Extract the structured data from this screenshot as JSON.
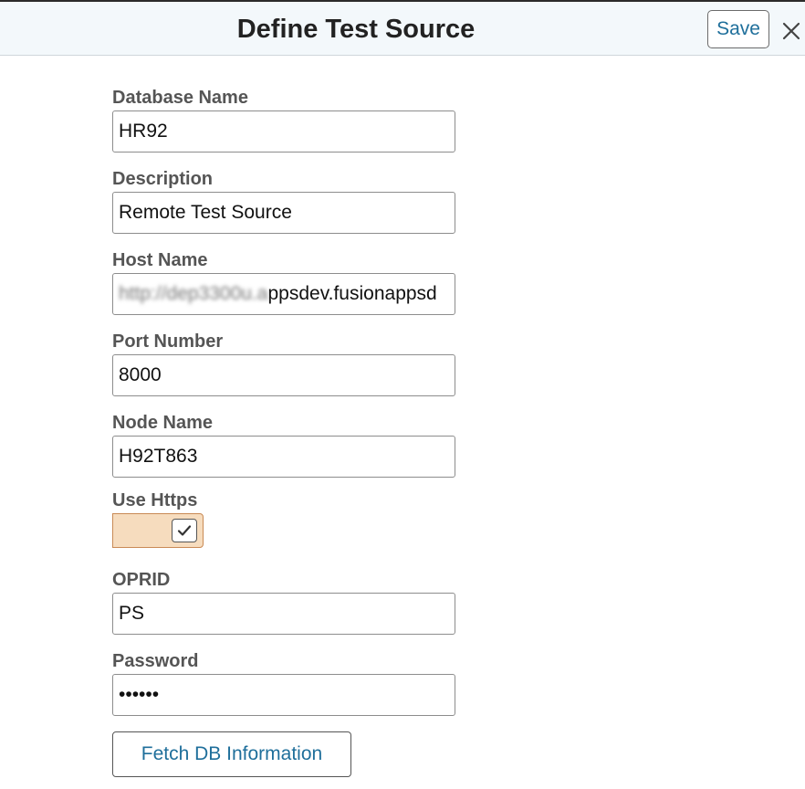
{
  "header": {
    "title": "Define Test Source",
    "save_label": "Save",
    "close_icon": "close-icon"
  },
  "form": {
    "database_name": {
      "label": "Database Name",
      "value": "HR92"
    },
    "description": {
      "label": "Description",
      "value": "Remote Test Source"
    },
    "host_name": {
      "label": "Host Name",
      "value_obscured": "http://dep3300u.a",
      "value_visible": "ppsdev.fusionappsd"
    },
    "port_number": {
      "label": "Port Number",
      "value": "8000"
    },
    "node_name": {
      "label": "Node Name",
      "value": "H92T863"
    },
    "use_https": {
      "label": "Use Https",
      "checked": true,
      "accent_color": "#f6dcbe"
    },
    "oprid": {
      "label": "OPRID",
      "value": "PS"
    },
    "password": {
      "label": "Password",
      "value": "••••••"
    },
    "fetch_label": "Fetch DB Information"
  },
  "colors": {
    "link": "#1f6f9b",
    "header_bg": "#f3f8fb",
    "label": "#555555"
  }
}
